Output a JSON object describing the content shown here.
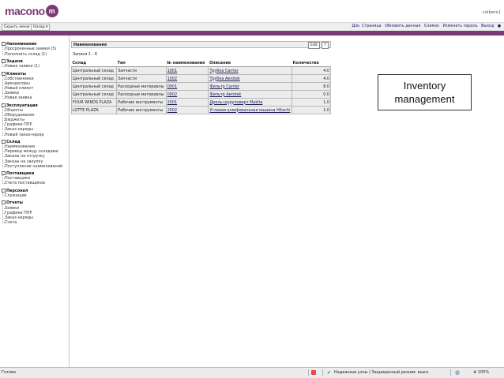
{
  "header": {
    "logo_text": "macono",
    "logo_mark": "m",
    "username": "colbers1"
  },
  "toolbar": {
    "hide_menu_label": "Скрыть меню",
    "back_label": "Назад ▾",
    "links": [
      "Док. Страница",
      "Обновить данные",
      "Снимок",
      "Изменить пароль",
      "Выход",
      "●"
    ]
  },
  "sidebar": {
    "sections": [
      {
        "title": "Напоминания",
        "items": [
          "Просроченные заявки (5)",
          "Пополнить склад (1)"
        ]
      },
      {
        "title": "Задачи",
        "items": [
          "Новые заявки (1)"
        ]
      },
      {
        "title": "Клиенты",
        "items": [
          "Собственники",
          "Арендаторы",
          "Новый клиент",
          "Заявки",
          "Новая заявка"
        ]
      },
      {
        "title": "Эксплуатация",
        "items": [
          "Объекты",
          "Оборудование",
          "Бюджеты",
          "Графики ППР",
          "Заказ-наряды",
          "Новый заказ-наряд"
        ]
      },
      {
        "title": "Склад",
        "items": [
          "Наименования",
          "Перевод между складами",
          "Заказы на отгрузку",
          "Заказы на закупку",
          "Поступление наименований"
        ]
      },
      {
        "title": "Поставщики",
        "items": [
          "Поставщики",
          "Счета поставщиков"
        ]
      },
      {
        "title": "Персонал",
        "items": [
          "Служащие"
        ]
      },
      {
        "title": "Отчеты",
        "items": [
          "Заявки",
          "Графики ППР",
          "Заказ-наряды",
          "Счета"
        ]
      }
    ]
  },
  "panel": {
    "title": "Наименования",
    "edit_label": "Edit",
    "help_label": "?",
    "records": "Записи 1 - 6",
    "columns": [
      "Склад",
      "Тип",
      "№ наименования",
      "Описание",
      "Количество"
    ],
    "rows": [
      [
        "Центральный склад",
        "Запчасти",
        "1001",
        "Трубка Carrier",
        "4.0"
      ],
      [
        "Центральный склад",
        "Запчасти",
        "1002",
        "Трубка Aerotek",
        "4.0"
      ],
      [
        "Центральный склад",
        "Расходные материалы",
        "0001",
        "Фильтр Carrier",
        "8.0"
      ],
      [
        "Центральный склад",
        "Расходные материалы",
        "0002",
        "Фильтр Aerotek",
        "0.0"
      ],
      [
        "FOUR WINDS PLAZA",
        "Рабочие инструменты",
        "2001",
        "Дрель-шуруповерт Makita",
        "1.0"
      ],
      [
        "LOTTE PLAZA",
        "Рабочие инструменты",
        "2002",
        "Угловая шлифовальная машина Hitachi",
        "1.0"
      ]
    ]
  },
  "caption": {
    "line1": "Inventory",
    "line2": "management"
  },
  "statusbar": {
    "status": "Готово",
    "security": "Надежные узлы | Защищенный режим: выкл.",
    "zoom": "105%"
  }
}
